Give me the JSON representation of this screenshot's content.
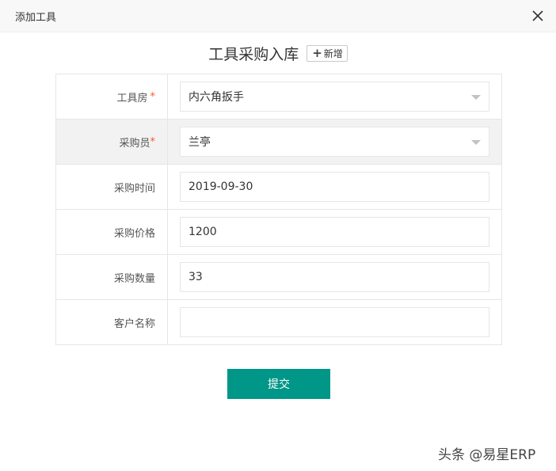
{
  "dialog": {
    "title": "添加工具",
    "close_icon": "close-icon"
  },
  "form": {
    "heading": "工具采购入库",
    "add_new_label": "新增",
    "add_new_icon": "plus-icon",
    "rows": [
      {
        "label": "工具房",
        "required_mark": "*",
        "type": "select",
        "value": "内六角扳手"
      },
      {
        "label": "采购员",
        "required_mark": "*",
        "type": "select",
        "value": "兰亭"
      },
      {
        "label": "采购时间",
        "type": "input",
        "value": "2019-09-30"
      },
      {
        "label": "采购价格",
        "type": "input",
        "value": "1200"
      },
      {
        "label": "采购数量",
        "type": "input",
        "value": "33"
      },
      {
        "label": "客户名称",
        "type": "input",
        "value": ""
      }
    ],
    "submit_label": "提交"
  },
  "watermark": "头条 @易星ERP",
  "colors": {
    "primary": "#009688",
    "required": "#ff5722",
    "header_bg": "#f8f8f8",
    "border": "#e6e6e6"
  }
}
